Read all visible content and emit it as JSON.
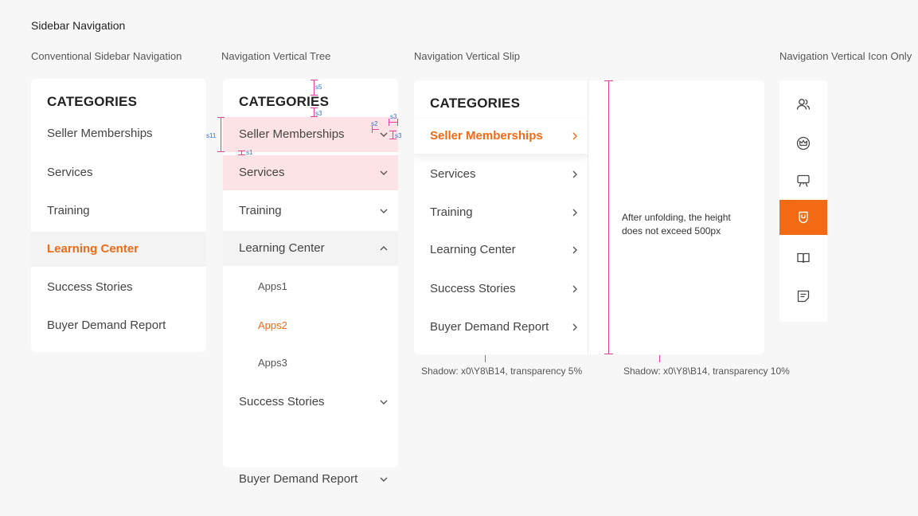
{
  "page_title": "Sidebar Navigation",
  "sections": {
    "conventional": "Conventional Sidebar Navigation",
    "tree": "Navigation Vertical Tree",
    "slip": "Navigation Vertical Slip",
    "icon_only": "Navigation Vertical Icon Only"
  },
  "conventional": {
    "heading": "CATEGORIES",
    "items": [
      "Seller Memberships",
      "Services",
      "Training",
      "Learning Center",
      "Success Stories",
      "Buyer Demand Report"
    ],
    "active": "Learning Center"
  },
  "tree": {
    "heading": "CATEGORIES",
    "items": [
      "Seller Memberships",
      "Services",
      "Training",
      "Learning Center",
      "Success Stories",
      "Buyer Demand Report"
    ],
    "children": [
      "Apps1",
      "Apps2",
      "Apps3"
    ],
    "active_child": "Apps2",
    "spacing_marks": [
      "s5",
      "s3",
      "s11",
      "s1",
      "s2",
      "s3",
      "s3"
    ]
  },
  "slip": {
    "heading": "CATEGORIES",
    "items": [
      "Seller Memberships",
      "Services",
      "Training",
      "Learning Center",
      "Success Stories",
      "Buyer Demand Report"
    ],
    "active": "Seller Memberships",
    "panel_note_line1": "After unfolding, the height",
    "panel_note_line2": "does not exceed 500px",
    "shadow_note_left": "Shadow: x0\\Y8\\B14, transparency 5%",
    "shadow_note_right": "Shadow: x0\\Y8\\B14, transparency 10%"
  },
  "icon_only": {
    "icons": [
      "users-icon",
      "crown-icon",
      "presentation-icon",
      "shield-icon",
      "book-icon",
      "note-icon"
    ],
    "active_index": 3
  },
  "colors": {
    "accent": "#f26a13",
    "pink_measure": "#e0409a",
    "highlight": "#fde3e5"
  }
}
